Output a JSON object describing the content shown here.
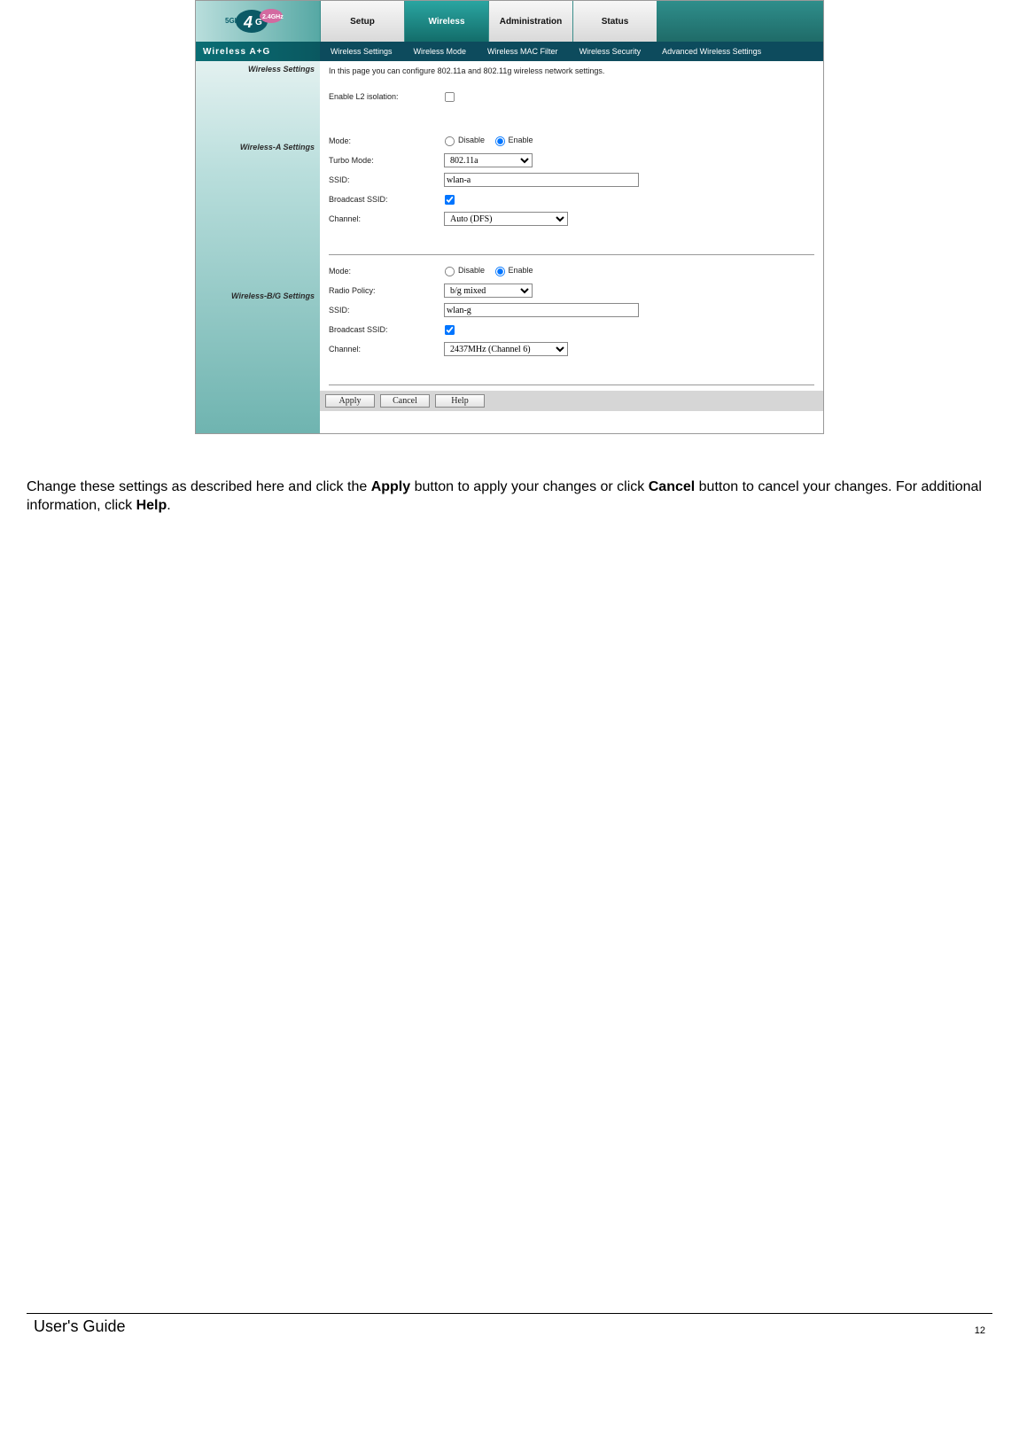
{
  "header": {
    "brand": "Wireless A+G",
    "tabs": [
      "Setup",
      "Wireless",
      "Administration",
      "Status"
    ],
    "active_tab": 1,
    "subnav": [
      "Wireless Settings",
      "Wireless Mode",
      "Wireless MAC Filter",
      "Wireless Security",
      "Advanced Wireless Settings"
    ]
  },
  "sidebar": {
    "labels": [
      "Wireless Settings",
      "Wireless-A Settings",
      "Wireless-B/G Settings"
    ]
  },
  "main": {
    "intro": "In this page you can configure 802.11a and 802.11g wireless network settings.",
    "l2_label": "Enable L2 isolation:",
    "l2_checked": false,
    "wa": {
      "mode_label": "Mode:",
      "mode_disable": "Disable",
      "mode_enable": "Enable",
      "mode_value": "enable",
      "turbo_label": "Turbo Mode:",
      "turbo_value": "802.11a",
      "ssid_label": "SSID:",
      "ssid_value": "wlan-a",
      "broadcast_label": "Broadcast SSID:",
      "broadcast_checked": true,
      "channel_label": "Channel:",
      "channel_value": "Auto (DFS)"
    },
    "wbg": {
      "mode_label": "Mode:",
      "mode_disable": "Disable",
      "mode_enable": "Enable",
      "mode_value": "enable",
      "policy_label": "Radio Policy:",
      "policy_value": "b/g mixed",
      "ssid_label": "SSID:",
      "ssid_value": "wlan-g",
      "broadcast_label": "Broadcast SSID:",
      "broadcast_checked": true,
      "channel_label": "Channel:",
      "channel_value": "2437MHz (Channel 6)"
    },
    "buttons": {
      "apply": "Apply",
      "cancel": "Cancel",
      "help": "Help"
    }
  },
  "doc": {
    "text_pre": "Change these settings as described here and click the ",
    "b1": "Apply",
    "text_mid1": " button to apply your changes or click ",
    "b2": "Cancel",
    "text_mid2": " button to cancel your changes. For additional information, click ",
    "b3": "Help",
    "text_end": "."
  },
  "footer": {
    "guide": "User's Guide",
    "page": "12"
  }
}
